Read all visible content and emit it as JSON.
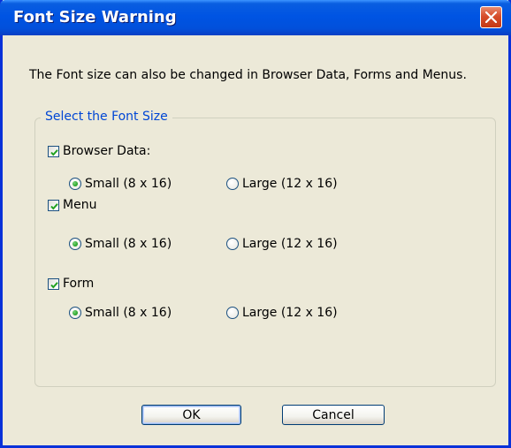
{
  "dialog": {
    "title": "Font Size Warning",
    "message": "The Font size can also be changed in Browser Data, Forms and Menus."
  },
  "group": {
    "legend": "Select the Font Size",
    "sections": [
      {
        "checkbox_label": "Browser Data:",
        "checked": true,
        "small_label": "Small (8 x 16)",
        "large_label": "Large (12 x 16)",
        "selected": "small"
      },
      {
        "checkbox_label": "Menu",
        "checked": true,
        "small_label": "Small (8 x 16)",
        "large_label": "Large (12 x 16)",
        "selected": "small"
      },
      {
        "checkbox_label": "Form",
        "checked": true,
        "small_label": "Small (8 x 16)",
        "large_label": "Large (12 x 16)",
        "selected": "small"
      }
    ]
  },
  "buttons": {
    "ok": "OK",
    "cancel": "Cancel"
  },
  "colors": {
    "title_bar": "#0054e3",
    "dialog_bg": "#ece9d8",
    "legend_text": "#0046d5",
    "check_mark": "#21a121",
    "close_button": "#d64d2b"
  },
  "icons": {
    "close": "close-icon",
    "check": "checkmark-icon",
    "radio": "radio-dot-icon"
  }
}
